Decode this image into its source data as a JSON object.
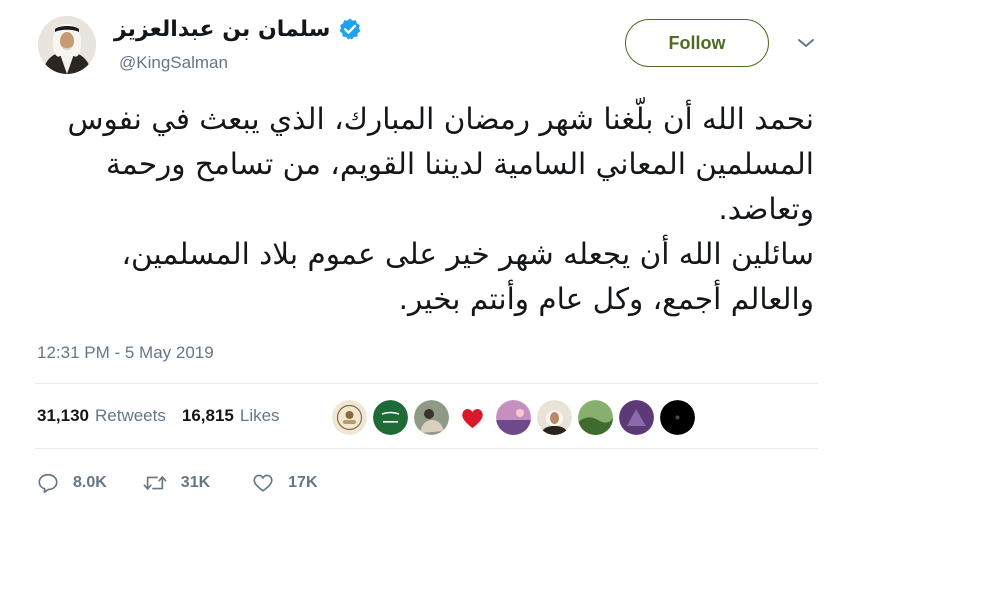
{
  "user": {
    "name": "سلمان بن عبدالعزيز",
    "handle": "@KingSalman",
    "verified": true
  },
  "follow_label": "Follow",
  "tweet": {
    "paragraphs": [
      "نحمد الله أن بلّغنا شهر رمضان المبارك، الذي يبعث في نفوس المسلمين المعاني السامية لديننا القويم، من تسامح ورحمة وتعاضد.",
      "سائلين الله أن يجعله شهر خير على عموم بلاد المسلمين، والعالم أجمع، وكل عام وأنتم بخير."
    ],
    "timestamp": "12:31 PM - 5 May 2019"
  },
  "stats": {
    "retweets_count": "31,130",
    "retweets_label": "Retweets",
    "likes_count": "16,815",
    "likes_label": "Likes"
  },
  "likers": [
    {
      "name": "liker-1",
      "color": "#e7dcc8"
    },
    {
      "name": "liker-2",
      "color": "#1f6b38"
    },
    {
      "name": "liker-3",
      "color": "#7a8a74"
    },
    {
      "name": "liker-4",
      "color": "#d9182a"
    },
    {
      "name": "liker-5",
      "color": "#b07ab8"
    },
    {
      "name": "liker-6",
      "color": "#3b3025"
    },
    {
      "name": "liker-7",
      "color": "#4f7f3e"
    },
    {
      "name": "liker-8",
      "color": "#5c3a78"
    },
    {
      "name": "liker-9",
      "color": "#000000"
    }
  ],
  "actions": {
    "replies": "8.0K",
    "retweets": "31K",
    "likes": "17K"
  },
  "colors": {
    "follow_accent": "#4d6b22",
    "verified_blue": "#1da1f2",
    "secondary_text": "#657786",
    "primary_text": "#14171a"
  }
}
